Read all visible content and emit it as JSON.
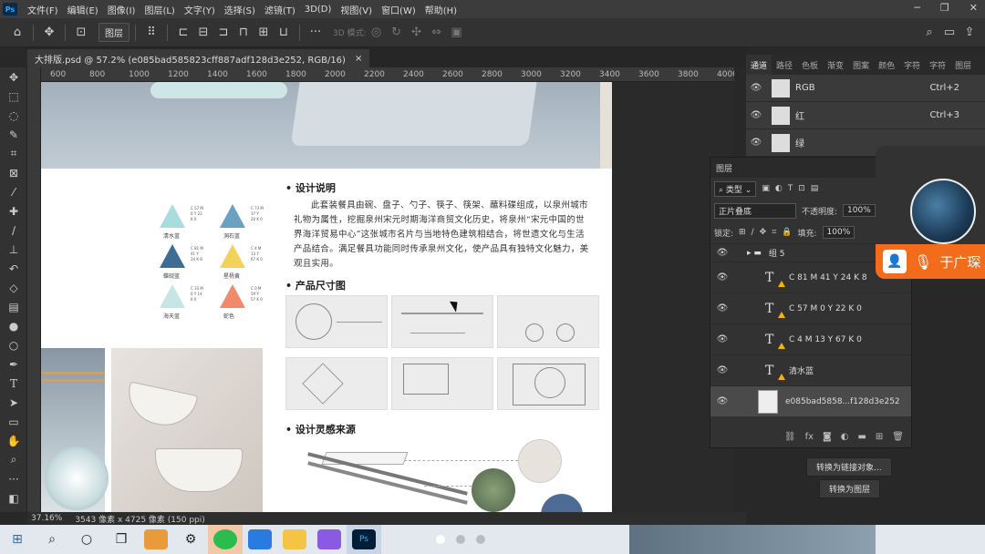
{
  "app": {
    "logo": "Ps"
  },
  "menu": [
    "文件(F)",
    "编辑(E)",
    "图像(I)",
    "图层(L)",
    "文字(Y)",
    "选择(S)",
    "滤镜(T)",
    "3D(D)",
    "视图(V)",
    "窗口(W)",
    "帮助(H)"
  ],
  "options": {
    "layer_select": "图层",
    "mode_3d": "3D 模式:"
  },
  "document_tab": {
    "title": "大排版.psd @ 57.2% (e085bad585823cff887adf128d3e252, RGB/16)",
    "close": "×"
  },
  "ruler_ticks": [
    "600",
    "800",
    "1000",
    "1200",
    "1400",
    "1600",
    "1800",
    "2000",
    "2200",
    "2400",
    "2600",
    "2800",
    "3000",
    "3200",
    "3400",
    "3600",
    "3800",
    "4000"
  ],
  "swatches": [
    {
      "name": "清水蓝",
      "cmyk": "C 57 M 0 Y 22 K 0",
      "color": "#a9dcdf"
    },
    {
      "name": "洞石蓝",
      "cmyk": "C 73 M 37 Y 20 K 0",
      "color": "#6aa0c2"
    },
    {
      "name": "蝶砚蓝",
      "cmyk": "C 81 M 41 Y 24 K 8",
      "color": "#3d6d93"
    },
    {
      "name": "星杨黄",
      "cmyk": "C 4 M 13 Y 67 K 0",
      "color": "#f3d25c"
    },
    {
      "name": "海天蓝",
      "cmyk": "C 33 M 0 Y 14 K 0",
      "color": "#c6e6e6"
    },
    {
      "name": "蛇色",
      "cmyk": "C 0 M 59 Y 57 K 0",
      "color": "#f08a6b"
    }
  ],
  "design": {
    "sec1": "• 设计说明",
    "desc": "此套装餐具由碗、盘子、勺子、筷子、筷架、蘸料碟组成，以泉州城市礼物为属性，挖掘泉州宋元时期海洋商贸文化历史，将泉州“宋元中国的世界海洋贸易中心”这张城市名片与当地特色建筑相结合，将世遗文化与生活产品结合。满足餐具功能同时传承泉州文化，使产品具有独特文化魅力，美观且实用。",
    "sec2": "• 产品尺寸图",
    "sec3": "• 设计灵感来源"
  },
  "channels": {
    "tabs": [
      "通道",
      "路径",
      "色板",
      "渐变",
      "图案",
      "颜色",
      "字符",
      "字符",
      "图层"
    ],
    "rows": [
      {
        "name": "RGB",
        "shortcut": "Ctrl+2"
      },
      {
        "name": "红",
        "shortcut": "Ctrl+3"
      },
      {
        "name": "绿",
        "shortcut": ""
      }
    ]
  },
  "layers": {
    "title": "图层",
    "filter": "类型",
    "blend": "正片叠底",
    "opacity_label": "不透明度:",
    "opacity": "100%",
    "lock_label": "锁定:",
    "fill_label": "填充:",
    "fill": "100%",
    "group": "组 5",
    "items": [
      "C 81 M 41 Y 24 K 8",
      "C 57 M 0 Y 22 K 0",
      "C 4 M 13 Y 67 K 0",
      "清水蓝",
      "e085bad5858...f128d3e252"
    ]
  },
  "context": {
    "convert_link": "转换为链接对象...",
    "convert_layer": "转换为图层"
  },
  "call": {
    "name": "于广琛"
  },
  "status": {
    "zoom": "37.16%",
    "size": "3543 像素 x 4725 像素 (150 ppi)"
  },
  "colors": {
    "accent": "#31a8ff",
    "call": "#f36c1c",
    "warning": "#f5b400"
  }
}
